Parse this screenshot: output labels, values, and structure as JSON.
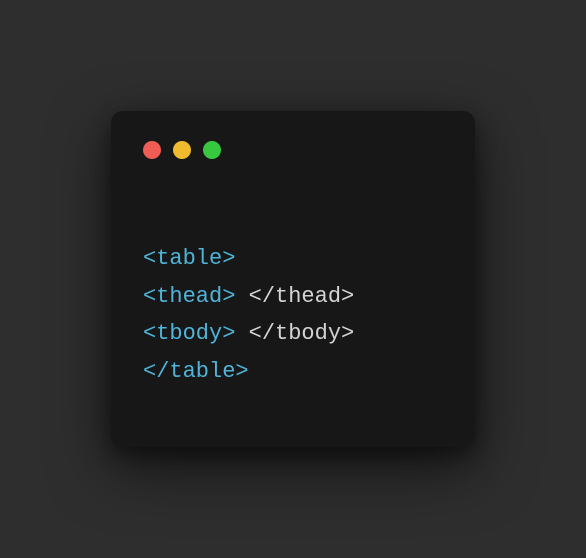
{
  "window": {
    "trafficLights": [
      "red",
      "yellow",
      "green"
    ]
  },
  "code": {
    "line1": {
      "tagOpen": "<table>"
    },
    "line2": {
      "tagOpen": "<thead>",
      "sep": " ",
      "tagClose": "</thead>"
    },
    "line3": {
      "tagOpen": "<tbody>",
      "sep": " ",
      "tagClose": "</tbody>"
    },
    "line4": {
      "tagClose": "</table>"
    }
  }
}
